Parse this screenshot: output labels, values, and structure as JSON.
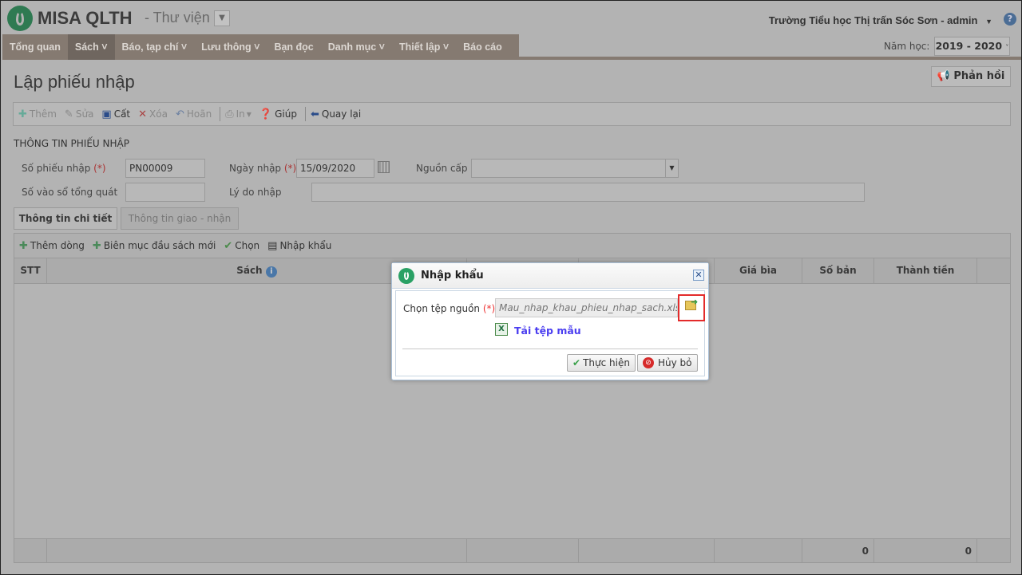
{
  "header": {
    "brand": "MISA QLTH",
    "module": "- Thư viện",
    "user": "Trường Tiểu học Thị trấn Sóc Sơn - admin",
    "year_label": "Năm học:",
    "year": "2019 - 2020"
  },
  "nav": [
    {
      "label": "Tổng quan"
    },
    {
      "label": "Sách ˅"
    },
    {
      "label": "Báo, tạp chí ˅"
    },
    {
      "label": "Lưu thông ˅"
    },
    {
      "label": "Bạn đọc"
    },
    {
      "label": "Danh mục ˅"
    },
    {
      "label": "Thiết lập ˅"
    },
    {
      "label": "Báo cáo"
    }
  ],
  "page": {
    "title": "Lập phiếu nhập",
    "feedback": "Phản hồi"
  },
  "toolbar": {
    "add": "Thêm",
    "edit": "Sửa",
    "save": "Cất",
    "delete": "Xóa",
    "undo": "Hoãn",
    "print": "In",
    "help": "Giúp",
    "back": "Quay lại"
  },
  "form": {
    "section": "THÔNG TIN PHIẾU NHẬP",
    "req": "(*)",
    "receipt_no_label": "Số phiếu nhập",
    "receipt_no": "PN00009",
    "date_label": "Ngày nhập",
    "date": "15/09/2020",
    "source_label": "Nguồn cấp",
    "ledger_label": "Số vào sổ tổng quát",
    "reason_label": "Lý do nhập"
  },
  "tabs": {
    "detail": "Thông tin chi tiết",
    "delivery": "Thông tin giao - nhận"
  },
  "grid": {
    "add_row": "Thêm dòng",
    "catalog": "Biên mục đầu sách mới",
    "choose": "Chọn",
    "import": "Nhập khẩu",
    "columns": {
      "stt": "STT",
      "book": "Sách",
      "price": "Giá bìa",
      "copies": "Số bản",
      "total": "Thành tiền"
    },
    "footer": {
      "copies": "0",
      "total": "0"
    }
  },
  "dialog": {
    "title": "Nhập khẩu",
    "file_label": "Chọn tệp nguồn",
    "req": "(*)",
    "file": "Mau_nhap_khau_phieu_nhap_sach.xls",
    "template_link": "Tải tệp mẫu",
    "ok": "Thực hiện",
    "cancel": "Hủy bỏ"
  }
}
